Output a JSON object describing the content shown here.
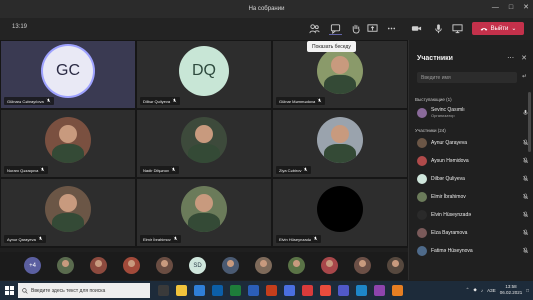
{
  "window": {
    "title": "На собрании"
  },
  "toolbar": {
    "timer": "13:19",
    "leave_label": "Выйти"
  },
  "tooltip": {
    "text": "Показать беседу"
  },
  "tiles": [
    {
      "name": "Gülnarə Cəbrayılova",
      "initials": "GC",
      "color": "#5b5fa0",
      "photo": false,
      "speaking": true
    },
    {
      "name": "Dilbər Quliyeva",
      "initials": "DQ",
      "color": "#c8e6d6",
      "photo": false,
      "speaking": false
    },
    {
      "name": "Gülnar Məmmədova",
      "initials": "",
      "color": "#8a9a6a",
      "photo": true,
      "speaking": false
    },
    {
      "name": "Nuranı Qəzaqova",
      "initials": "",
      "color": "#7a5040",
      "photo": true,
      "speaking": false
    },
    {
      "name": "Nadir Dilşənov",
      "initials": "",
      "color": "#3d4a3b",
      "photo": true,
      "speaking": false
    },
    {
      "name": "Ziya Cəbirov",
      "initials": "",
      "color": "#9aa3ad",
      "photo": true,
      "speaking": false
    },
    {
      "name": "Aynur Qarayeva",
      "initials": "",
      "color": "#6b5646",
      "photo": true,
      "speaking": false
    },
    {
      "name": "Elmir İbrahimov",
      "initials": "",
      "color": "#6b7b5a",
      "photo": true,
      "speaking": false
    },
    {
      "name": "Elvin Hüseynzadə",
      "initials": "",
      "color": "#000000",
      "photo": true,
      "speaking": false
    }
  ],
  "strip": [
    {
      "initials": "+4",
      "color": "#5b5fa0"
    },
    {
      "initials": "",
      "color": "#5a6b4e"
    },
    {
      "initials": "",
      "color": "#8d4a3e"
    },
    {
      "initials": "",
      "color": "#a24a3a"
    },
    {
      "initials": "",
      "color": "#6a4d42"
    },
    {
      "initials": "SD",
      "color": "#cfe6dc"
    },
    {
      "initials": "",
      "color": "#4a5a72"
    },
    {
      "initials": "",
      "color": "#7e6a5a"
    },
    {
      "initials": "",
      "color": "#5a7346"
    },
    {
      "initials": "",
      "color": "#a8474a"
    },
    {
      "initials": "",
      "color": "#6b4f46"
    },
    {
      "initials": "",
      "color": "#56483e"
    }
  ],
  "panel": {
    "title": "Участники",
    "invite_placeholder": "Введите имя",
    "presenters_header": "Выступающие (1)",
    "attendees_header": "Участники (24)",
    "presenter": {
      "name": "Sevinc Qasımlı",
      "role": "Организатор"
    },
    "attendees": [
      {
        "name": "Aynur Qarayeva",
        "color": "#6b5646"
      },
      {
        "name": "Aysun Həmidova",
        "color": "#b04a4a"
      },
      {
        "name": "Dilbər Quliyeva",
        "color": "#cfe6dc"
      },
      {
        "name": "Elmir İbrahimov",
        "color": "#6b7b5a"
      },
      {
        "name": "Elvin Hüseynzadə",
        "color": "#2a2a2a"
      },
      {
        "name": "Elza Bayramova",
        "color": "#7a5a5a"
      },
      {
        "name": "Fatimə Hüseynova",
        "color": "#4e6a8a"
      }
    ]
  },
  "taskbar": {
    "search_placeholder": "Введите здесь текст для поиска",
    "lang": "АЗЕ",
    "time": "13:58",
    "date": "06.02.2021"
  }
}
